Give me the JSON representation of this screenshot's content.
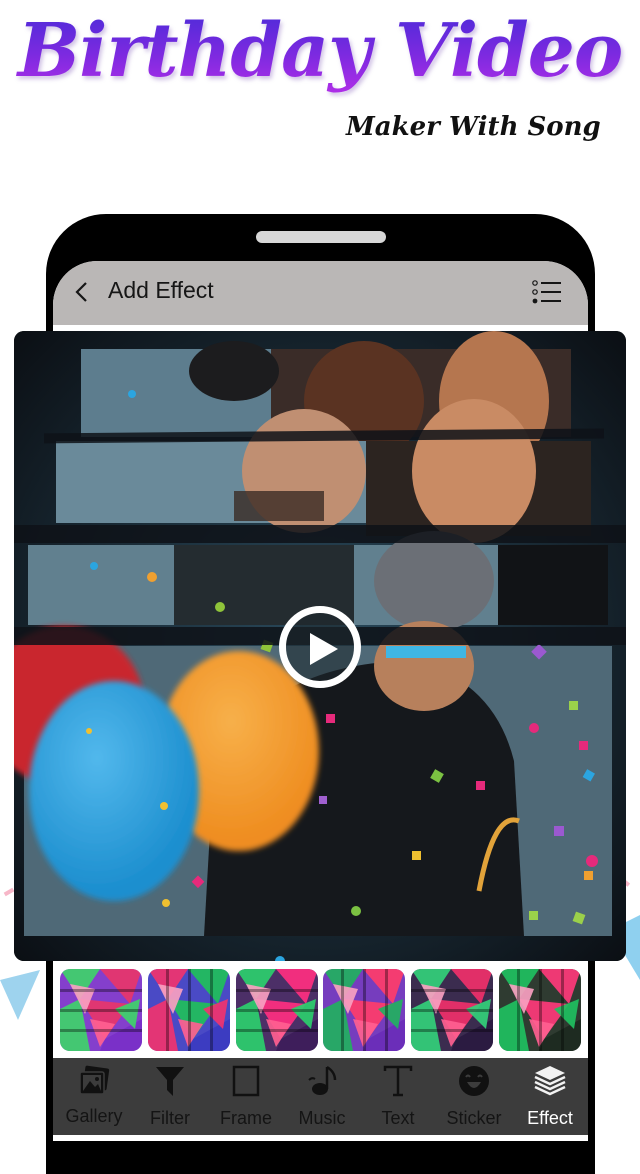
{
  "promo": {
    "title": "Birthday Video",
    "subtitle": "Maker With Song"
  },
  "appbar": {
    "title": "Add Effect",
    "back_icon": "chevron-left-icon",
    "menu_icon": "list-icon"
  },
  "player": {
    "play_icon": "play-icon",
    "state": "paused"
  },
  "effects": {
    "thumbnails": [
      {
        "name": "effect-1",
        "colors": [
          "#e8356a",
          "#3fd26a",
          "#7a2fc8"
        ]
      },
      {
        "name": "effect-2",
        "colors": [
          "#1fbf5a",
          "#f0336e",
          "#3b3bc0"
        ]
      },
      {
        "name": "effect-3",
        "colors": [
          "#ff2f80",
          "#2bcf6c",
          "#3d1d5a"
        ]
      },
      {
        "name": "effect-4",
        "colors": [
          "#ff3c6a",
          "#22b060",
          "#6a2cb8"
        ]
      },
      {
        "name": "effect-5",
        "colors": [
          "#f0306a",
          "#33d07a",
          "#2a1a40"
        ]
      },
      {
        "name": "effect-6",
        "colors": [
          "#ff3a7a",
          "#20c060",
          "#1d2a20"
        ]
      }
    ]
  },
  "toolbar": {
    "items": [
      {
        "label": "Gallery",
        "icon": "gallery-icon",
        "active": false
      },
      {
        "label": "Filter",
        "icon": "filter-icon",
        "active": false
      },
      {
        "label": "Frame",
        "icon": "frame-icon",
        "active": false
      },
      {
        "label": "Music",
        "icon": "music-icon",
        "active": false
      },
      {
        "label": "Text",
        "icon": "text-icon",
        "active": false
      },
      {
        "label": "Sticker",
        "icon": "sticker-icon",
        "active": false
      },
      {
        "label": "Effect",
        "icon": "layers-icon",
        "active": true
      }
    ]
  },
  "colors": {
    "title_gradient_start": "#4a2bd8",
    "title_gradient_end": "#b02ee8",
    "appbar_bg": "#bab7b6",
    "toolbar_bg": "#3c3c3c",
    "active_label": "#ffffff"
  }
}
